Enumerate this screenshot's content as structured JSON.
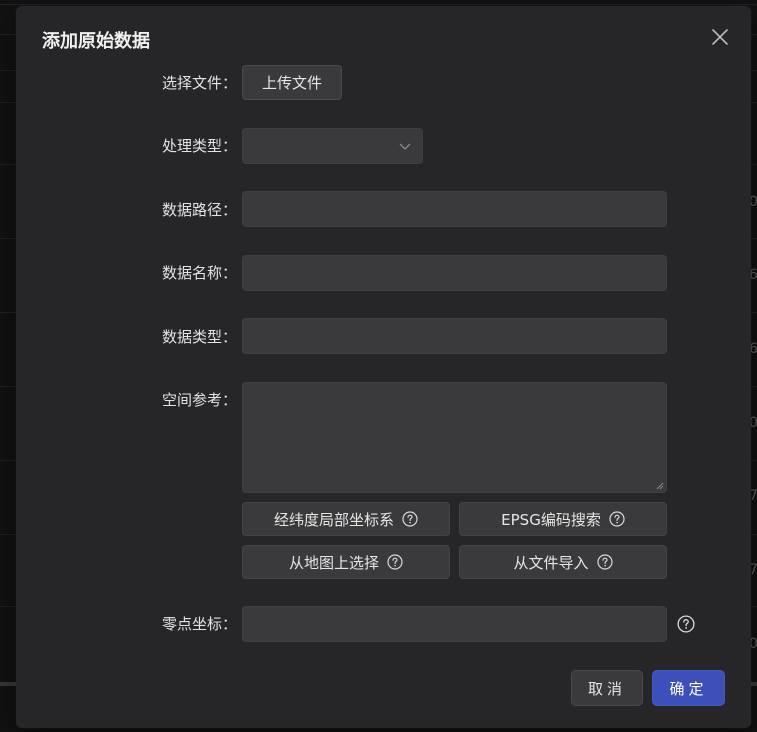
{
  "background": {
    "edge_chars": [
      "0",
      "6",
      "6",
      "0",
      "7",
      "7",
      "0"
    ]
  },
  "dialog": {
    "title": "添加原始数据",
    "close_icon": "close-icon"
  },
  "form": {
    "file": {
      "label": "选择文件：",
      "upload_button": "上传文件"
    },
    "process_type": {
      "label": "处理类型：",
      "value": ""
    },
    "data_path": {
      "label": "数据路径：",
      "value": ""
    },
    "data_name": {
      "label": "数据名称：",
      "value": ""
    },
    "data_type": {
      "label": "数据类型：",
      "value": ""
    },
    "spatial_ref": {
      "label": "空间参考：",
      "value": "",
      "buttons": [
        {
          "label": "经纬度局部坐标系",
          "icon": "help-icon"
        },
        {
          "label": "EPSG编码搜索",
          "icon": "help-icon"
        },
        {
          "label": "从地图上选择",
          "icon": "help-icon"
        },
        {
          "label": "从文件导入",
          "icon": "help-icon"
        }
      ]
    },
    "origin": {
      "label": "零点坐标：",
      "value": "",
      "icon": "help-icon"
    }
  },
  "footer": {
    "cancel_label": "取消",
    "ok_label": "确定"
  },
  "colors": {
    "accent": "#3d4fb8",
    "modal_bg": "#262628",
    "field_bg": "#3a3a3c"
  }
}
